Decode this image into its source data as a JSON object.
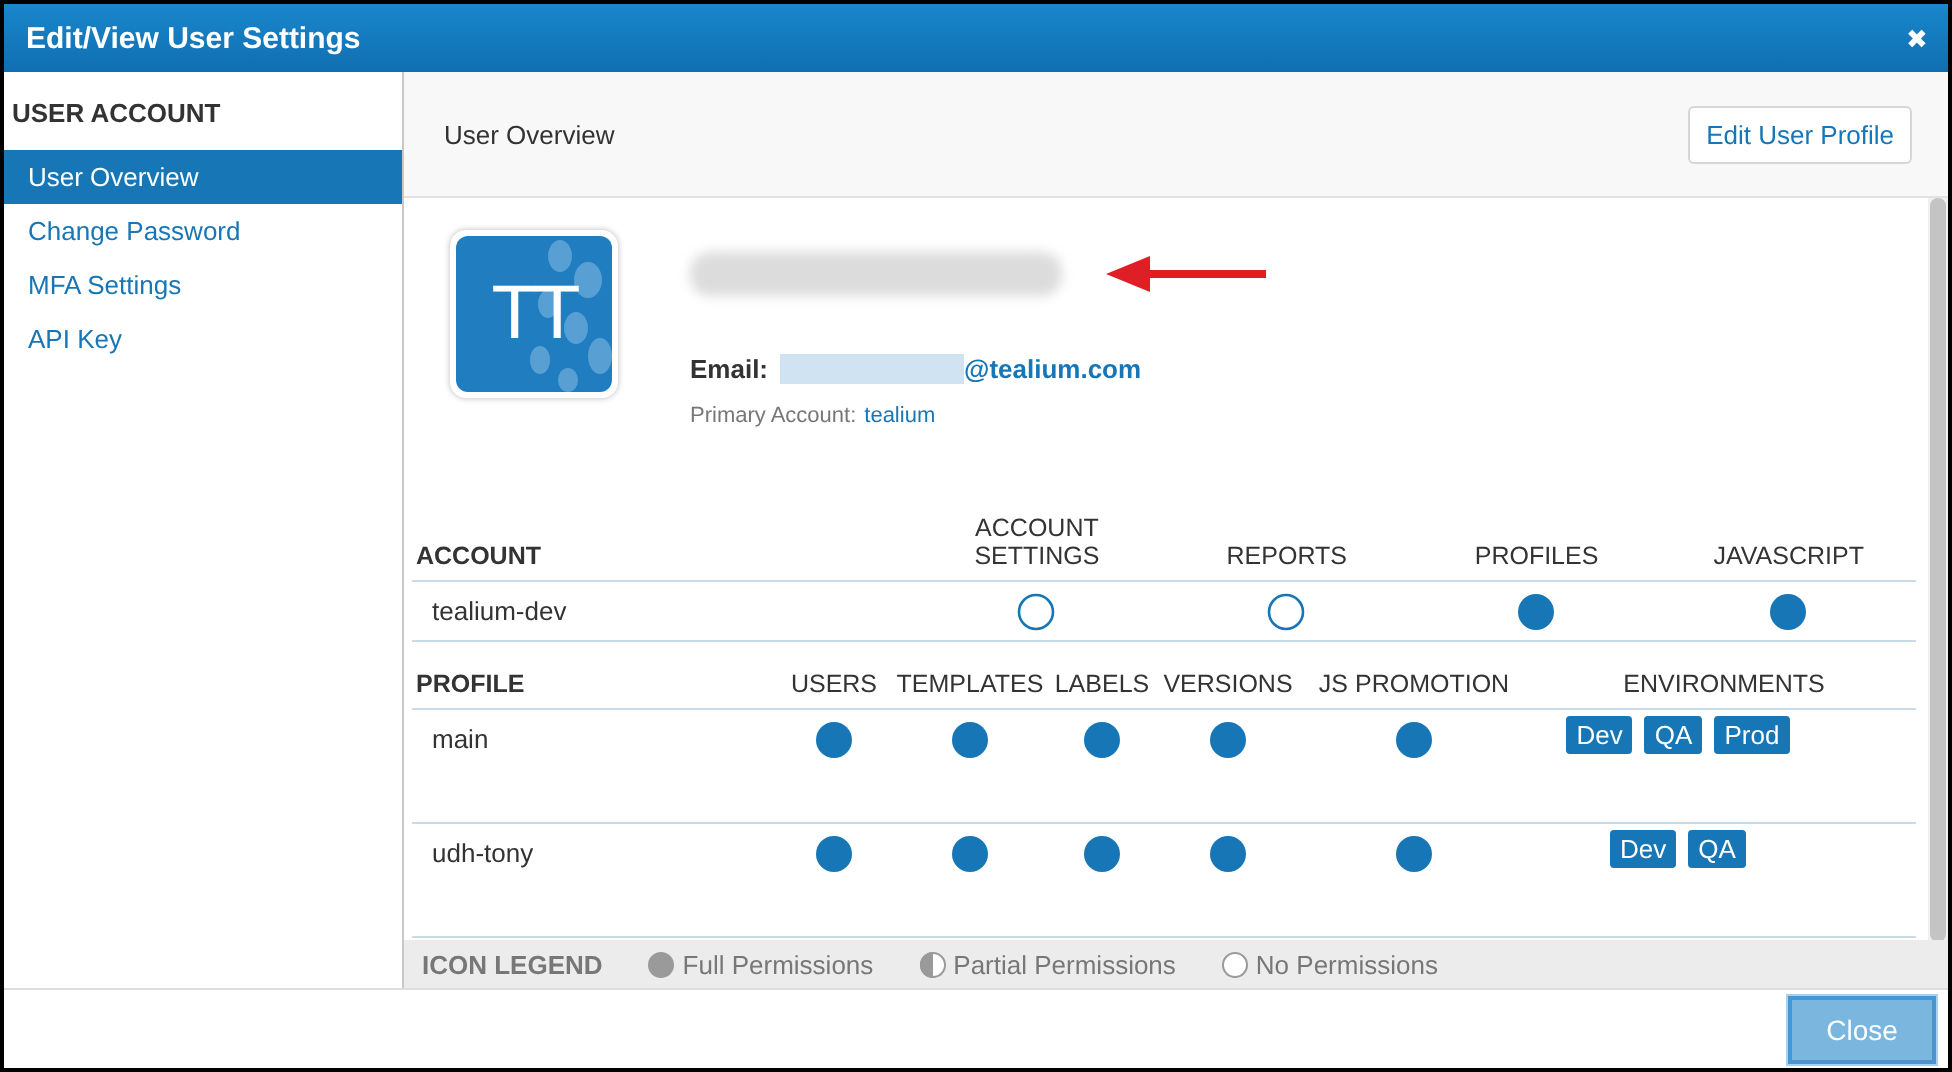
{
  "window": {
    "title": "Edit/View User Settings",
    "close": "✖"
  },
  "sidebar": {
    "heading": "USER ACCOUNT",
    "items": [
      {
        "label": "User Overview",
        "selected": true
      },
      {
        "label": "Change Password",
        "selected": false
      },
      {
        "label": "MFA Settings",
        "selected": false
      },
      {
        "label": "API Key",
        "selected": false
      }
    ]
  },
  "header": {
    "title": "User Overview",
    "button": "Edit User Profile"
  },
  "profile": {
    "initials": "TT",
    "email_label": "Email:",
    "email_domain": "@tealium.com",
    "primary_label": "Primary Account:",
    "primary_account": "tealium"
  },
  "account_table": {
    "columns": [
      "ACCOUNT",
      "ACCOUNT SETTINGS",
      "REPORTS",
      "PROFILES",
      "JAVASCRIPT"
    ],
    "rows": [
      {
        "name": "tealium-dev",
        "permissions": [
          {
            "granted": false
          },
          {
            "granted": false
          },
          {
            "granted": true
          },
          {
            "granted": true
          }
        ]
      }
    ]
  },
  "profile_table": {
    "columns": [
      "PROFILE",
      "USERS",
      "TEMPLATES",
      "LABELS",
      "VERSIONS",
      "JS PROMOTION",
      "ENVIRONMENTS"
    ],
    "rows": [
      {
        "name": "main",
        "permissions": [
          {
            "granted": true
          },
          {
            "granted": true
          },
          {
            "granted": true
          },
          {
            "granted": true
          },
          {
            "granted": true
          }
        ],
        "environments": [
          "Dev",
          "QA",
          "Prod"
        ]
      },
      {
        "name": "udh-tony",
        "permissions": [
          {
            "granted": true
          },
          {
            "granted": true
          },
          {
            "granted": true
          },
          {
            "granted": true
          },
          {
            "granted": true
          }
        ],
        "environments": [
          "Dev",
          "QA"
        ]
      }
    ]
  },
  "legend": {
    "title": "ICON LEGEND",
    "items": [
      {
        "kind": "full",
        "label": "Full Permissions"
      },
      {
        "kind": "partial",
        "label": "Partial Permissions"
      },
      {
        "kind": "none",
        "label": "No Permissions"
      }
    ]
  },
  "footer": {
    "button": "Close"
  }
}
